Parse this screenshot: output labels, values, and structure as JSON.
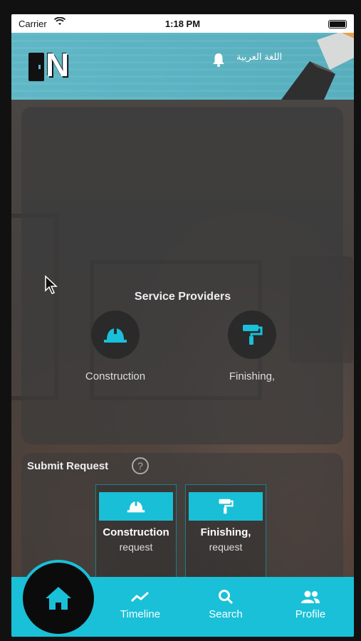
{
  "status_bar": {
    "carrier": "Carrier",
    "time": "1:18 PM"
  },
  "header": {
    "language_label": "اللغة العربية",
    "brand_letter": "N"
  },
  "service_providers": {
    "title": "Service Providers",
    "items": [
      {
        "label": "Construction",
        "icon": "hard-hat-icon"
      },
      {
        "label": "Finishing,",
        "icon": "paint-roller-icon"
      }
    ]
  },
  "submit_request": {
    "title": "Submit Request",
    "help_icon": "question-icon",
    "cards": [
      {
        "title": "Construction",
        "subtitle": "request",
        "icon": "hard-hat-icon"
      },
      {
        "title": "Finishing,",
        "subtitle": "request",
        "icon": "paint-roller-icon"
      }
    ]
  },
  "tabs": [
    {
      "label": "Timeline",
      "icon": "timeline-icon"
    },
    {
      "label": "Search",
      "icon": "search-icon"
    },
    {
      "label": "Profile",
      "icon": "profile-icon"
    }
  ],
  "colors": {
    "accent": "#19c0d8",
    "header": "#5fb7c6",
    "panel": "#3c3c3c"
  }
}
